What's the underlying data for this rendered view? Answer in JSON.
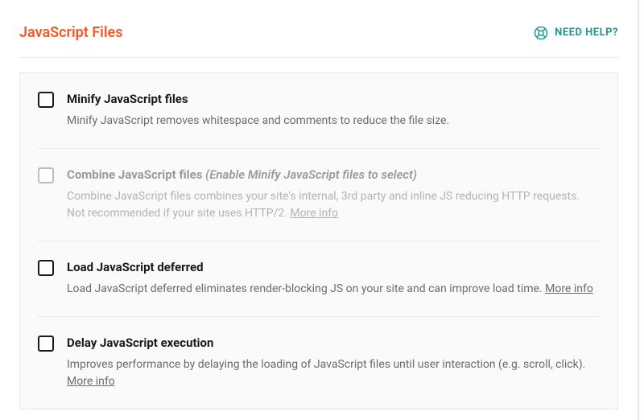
{
  "section": {
    "title": "JavaScript Files",
    "help_label": "NEED HELP?"
  },
  "options": [
    {
      "title": "Minify JavaScript files",
      "note": "",
      "desc": "Minify JavaScript removes whitespace and comments to reduce the file size.",
      "more_info": "",
      "disabled": false
    },
    {
      "title": "Combine JavaScript files",
      "note": "(Enable Minify JavaScript files to select)",
      "desc": "Combine JavaScript files combines your site's internal, 3rd party and inline JS reducing HTTP requests. Not recommended if your site uses HTTP/2. ",
      "more_info": "More info",
      "disabled": true
    },
    {
      "title": "Load JavaScript deferred",
      "note": "",
      "desc": "Load JavaScript deferred eliminates render-blocking JS on your site and can improve load time. ",
      "more_info": "More info",
      "disabled": false
    },
    {
      "title": "Delay JavaScript execution",
      "note": "",
      "desc": "Improves performance by delaying the loading of JavaScript files until user interaction (e.g. scroll, click). ",
      "more_info": "More info",
      "disabled": false
    }
  ]
}
